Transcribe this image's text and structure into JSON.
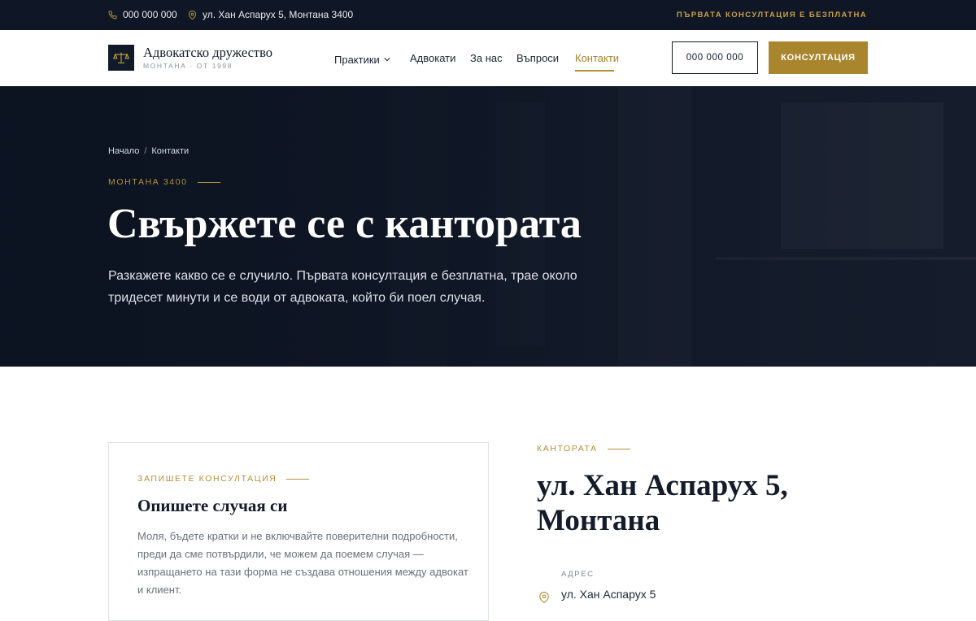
{
  "topbar": {
    "phone": "000 000 000",
    "address": "ул. Хан Аспарух 5, Монтана 3400",
    "promo": "ПЪРВАТА КОНСУЛТАЦИЯ Е БЕЗПЛАТНА"
  },
  "header": {
    "brand_name": "Адвокатско дружество",
    "brand_sub": "МОНТАНА · ОТ 1998",
    "nav": [
      "Практики",
      "Адвокати",
      "За нас",
      "Въпроси",
      "Контакти"
    ],
    "active_nav": "Контакти",
    "phone_button": "000 000 000",
    "consult_button": "КОНСУЛТАЦИЯ"
  },
  "hero": {
    "breadcrumb": [
      "Начало",
      "Контакти"
    ],
    "eyebrow": "МОНТАНА 3400",
    "title": "Свържете се с кантората",
    "lead": "Разкажете какво се е случило. Първата консултация е безплатна, трае около тридесет минути и се води от адвоката, който би поел случая."
  },
  "form_card": {
    "eyebrow": "ЗАПИШЕТЕ КОНСУЛТАЦИЯ",
    "title": "Опишете случая си",
    "text": "Моля, бъдете кратки и не включвайте поверителни подробности, преди да сме потвърдили, че можем да поемем случая — изпращането на тази форма не създава отношения между адвокат и клиент."
  },
  "office": {
    "eyebrow": "КАНТОРАТА",
    "title": "ул. Хан Аспарух 5, Монтана",
    "address_label": "АДРЕС",
    "address_value": "ул. Хан Аспарух 5"
  },
  "colors": {
    "navy": "#0f1726",
    "gold": "#a9852e",
    "white": "#ffffff"
  },
  "icons": [
    "phone-icon",
    "location-pin-icon",
    "scales-icon",
    "chevron-down-icon"
  ]
}
